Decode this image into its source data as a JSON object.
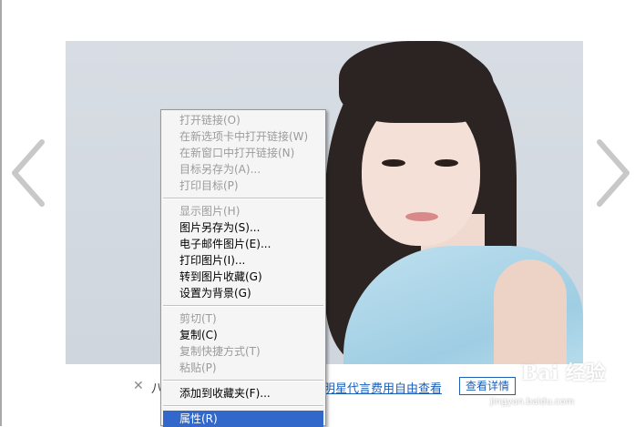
{
  "viewer": {
    "prev_label": "previous",
    "next_label": "next"
  },
  "bottom_bar": {
    "close_symbol": "✕",
    "prefix_text": "八",
    "link_text": "明星代言费用自由查看",
    "button_label": "查看详情"
  },
  "watermark": {
    "logo_text": "Bai 经验",
    "site_text": "jingyan.baidu.com"
  },
  "context_menu": {
    "groups": [
      [
        {
          "label": "打开链接(O)",
          "disabled": true
        },
        {
          "label": "在新选项卡中打开链接(W)",
          "disabled": true
        },
        {
          "label": "在新窗口中打开链接(N)",
          "disabled": true
        },
        {
          "label": "目标另存为(A)...",
          "disabled": true
        },
        {
          "label": "打印目标(P)",
          "disabled": true
        }
      ],
      [
        {
          "label": "显示图片(H)",
          "disabled": true
        },
        {
          "label": "图片另存为(S)...",
          "disabled": false
        },
        {
          "label": "电子邮件图片(E)...",
          "disabled": false
        },
        {
          "label": "打印图片(I)...",
          "disabled": false
        },
        {
          "label": "转到图片收藏(G)",
          "disabled": false
        },
        {
          "label": "设置为背景(G)",
          "disabled": false
        }
      ],
      [
        {
          "label": "剪切(T)",
          "disabled": true
        },
        {
          "label": "复制(C)",
          "disabled": false
        },
        {
          "label": "复制快捷方式(T)",
          "disabled": true
        },
        {
          "label": "粘贴(P)",
          "disabled": true
        }
      ],
      [
        {
          "label": "添加到收藏夹(F)...",
          "disabled": false
        }
      ],
      [
        {
          "label": "属性(R)",
          "disabled": false,
          "selected": true
        }
      ]
    ]
  },
  "colors": {
    "menu_highlight": "#3268c9",
    "link_blue": "#1c5fb6"
  }
}
